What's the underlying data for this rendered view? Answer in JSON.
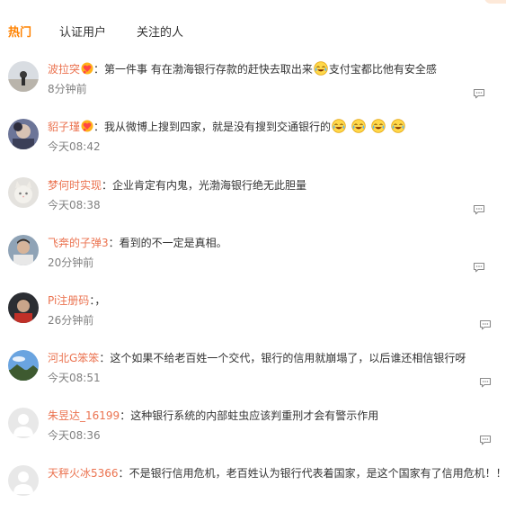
{
  "tabs": [
    {
      "label": "热门",
      "active": true
    },
    {
      "label": "认证用户",
      "active": false
    },
    {
      "label": "关注的人",
      "active": false
    }
  ],
  "comments": [
    {
      "user": "波拉突",
      "text_a": "第一件事 有在渤海银行存款的赶快去取出来",
      "text_b": "支付宝都比他有安全感",
      "time": "8分钟前",
      "badge": "vip-heart-badge",
      "emoji": "laugh-cry-emoji"
    },
    {
      "user": "貂子瑾",
      "text_a": "我从微博上搜到四家，就是没有搜到交通银行的",
      "text_b": "",
      "time": "今天08:42",
      "badge": "vip-heart-badge",
      "emoji": "laugh-cry-emoji"
    },
    {
      "user": "梦何时实现",
      "text_a": "企业肯定有内鬼，光渤海银行绝无此胆量",
      "text_b": "",
      "time": "今天08:38"
    },
    {
      "user": "飞奔的子弹3",
      "text_a": "看到的不一定是真相。",
      "text_b": "",
      "time": "20分钟前"
    },
    {
      "user": "Pi注册码",
      "text_a": "，",
      "text_b": "",
      "time": "26分钟前"
    },
    {
      "user": "河北G笨笨",
      "text_a": "这个如果不给老百姓一个交代，银行的信用就崩塌了，以后谁还相信银行呀",
      "text_b": "",
      "time": "今天08:51"
    },
    {
      "user": "朱昱达_16199",
      "text_a": "这种银行系统的内部蛀虫应该判重刑才会有警示作用",
      "text_b": "",
      "time": "今天08:36"
    },
    {
      "user": "天秤火冰5366",
      "text_a": "不是银行信用危机，老百姓认为银行代表着国家，是这个国家有了信用危机！！",
      "text_b": "",
      "time": ""
    }
  ],
  "colors": {
    "accent": "#ff8200",
    "username": "#eb7350",
    "meta": "#808080",
    "text": "#333333"
  }
}
